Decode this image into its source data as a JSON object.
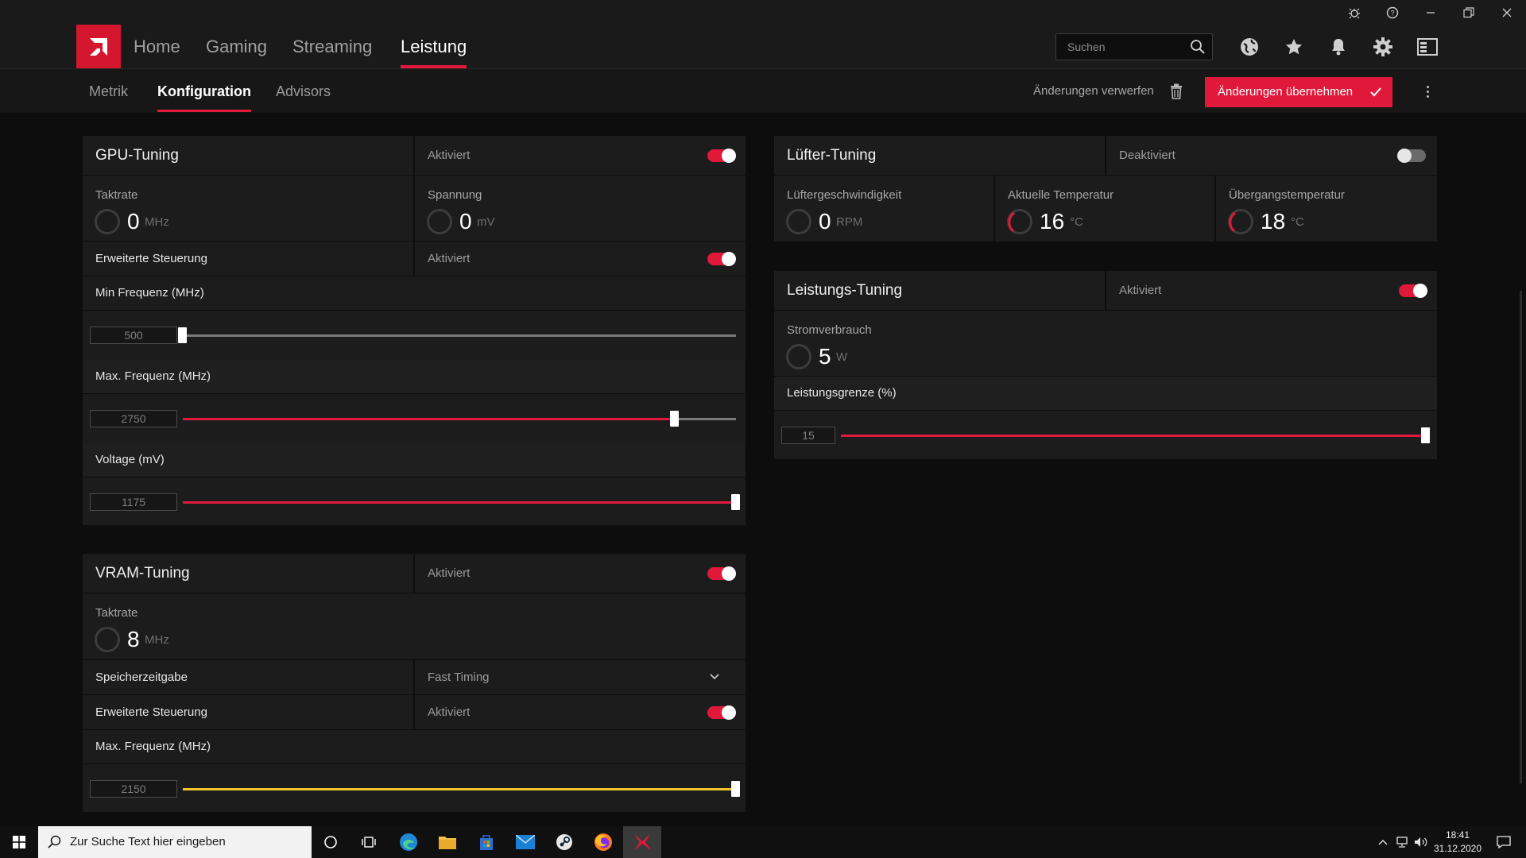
{
  "window": {
    "buttons": [
      "bug-report",
      "help",
      "minimize",
      "restore",
      "close"
    ]
  },
  "nav": {
    "items": [
      "Home",
      "Gaming",
      "Streaming",
      "Leistung"
    ],
    "active": "Leistung",
    "search_placeholder": "Suchen"
  },
  "subnav": {
    "items": [
      "Metrik",
      "Konfiguration",
      "Advisors"
    ],
    "active": "Konfiguration",
    "discard_label": "Änderungen verwerfen",
    "apply_label": "Änderungen übernehmen"
  },
  "colors": {
    "accent": "#e0193a",
    "vram_slider": "#f2c12e",
    "background": "#0d0d0d",
    "panel": "#1c1c1c"
  },
  "gpu": {
    "title": "GPU-Tuning",
    "status": "Aktiviert",
    "enabled": true,
    "clock_label": "Taktrate",
    "clock_value": "0",
    "clock_unit": "MHz",
    "voltage_label": "Spannung",
    "voltage_value": "0",
    "voltage_unit": "mV",
    "advanced_label": "Erweiterte Steuerung",
    "advanced_status": "Aktiviert",
    "advanced_enabled": true,
    "min_freq_label": "Min Frequenz (MHz)",
    "min_freq_value": "500",
    "min_freq_fraction": 0.0,
    "max_freq_label": "Max. Frequenz (MHz)",
    "max_freq_value": "2750",
    "max_freq_fraction": 0.89,
    "voltage_slider_label": "Voltage (mV)",
    "voltage_slider_value": "1175",
    "voltage_slider_fraction": 1.0
  },
  "vram": {
    "title": "VRAM-Tuning",
    "status": "Aktiviert",
    "enabled": true,
    "clock_label": "Taktrate",
    "clock_value": "8",
    "clock_unit": "MHz",
    "timing_label": "Speicherzeitgabe",
    "timing_value": "Fast Timing",
    "advanced_label": "Erweiterte Steuerung",
    "advanced_status": "Aktiviert",
    "advanced_enabled": true,
    "max_freq_label": "Max. Frequenz (MHz)",
    "max_freq_value": "2150",
    "max_freq_fraction": 1.0
  },
  "fan": {
    "title": "Lüfter-Tuning",
    "status": "Deaktiviert",
    "enabled": false,
    "speed_label": "Lüftergeschwindigkeit",
    "speed_value": "0",
    "speed_unit": "RPM",
    "temp_label": "Aktuelle Temperatur",
    "temp_value": "16",
    "temp_unit": "°C",
    "junction_label": "Übergangstemperatur",
    "junction_value": "18",
    "junction_unit": "°C"
  },
  "power": {
    "title": "Leistungs-Tuning",
    "status": "Aktiviert",
    "enabled": true,
    "consumption_label": "Stromverbrauch",
    "consumption_value": "5",
    "consumption_unit": "W",
    "limit_label": "Leistungsgrenze (%)",
    "limit_value": "15",
    "limit_fraction": 1.0
  },
  "taskbar": {
    "search_placeholder": "Zur Suche Text hier eingeben",
    "time": "18:41",
    "date": "31.12.2020",
    "apps": [
      "cortana",
      "task-view",
      "edge",
      "file-explorer",
      "store",
      "mail",
      "steam",
      "firefox",
      "amd-radeon-software"
    ]
  }
}
